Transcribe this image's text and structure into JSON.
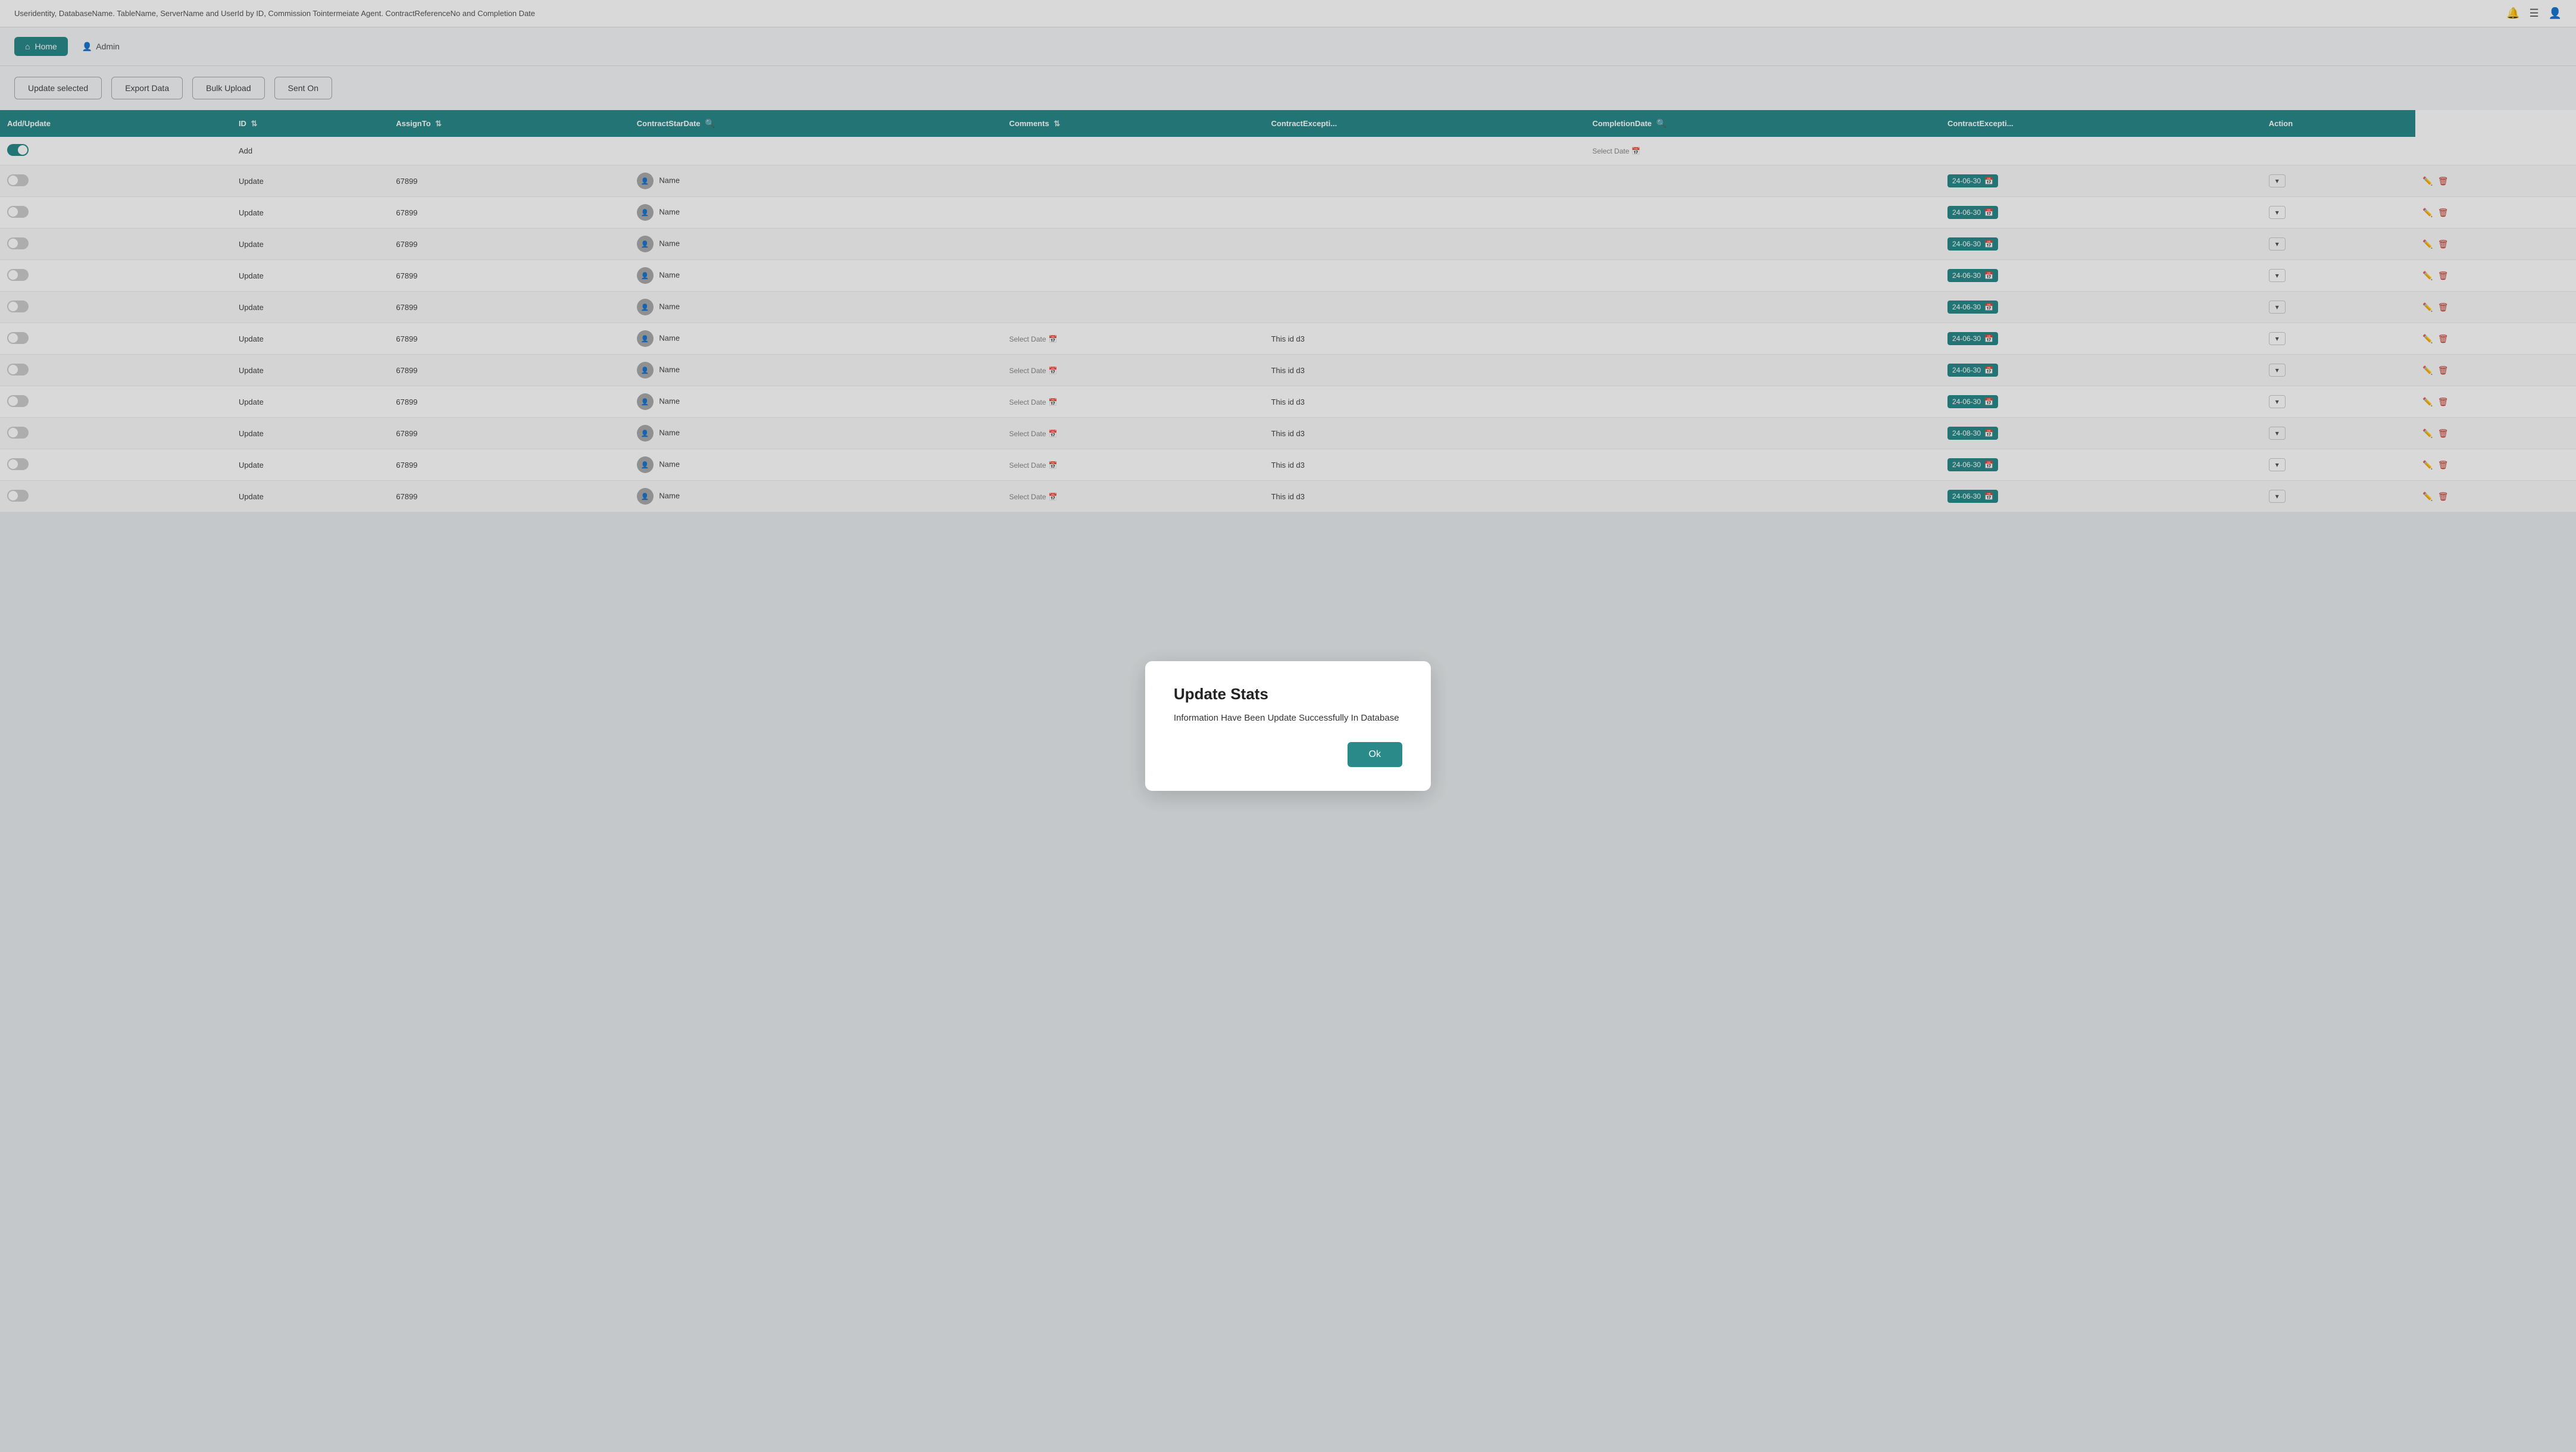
{
  "topbar": {
    "title": "Useridentity, DatabaseName. TableName, ServerName and UserId by ID, Commission Tointermeiate Agent. ContractReferenceNo and Completion Date",
    "icons": {
      "bell": "🔔",
      "menu": "☰",
      "user": "👤"
    }
  },
  "nav": {
    "home_label": "Home",
    "admin_label": "Admin"
  },
  "toolbar": {
    "update_selected_label": "Update selected",
    "export_data_label": "Export Data",
    "bulk_upload_label": "Bulk Upload",
    "sent_on_label": "Sent On"
  },
  "table": {
    "headers": [
      {
        "key": "add_update",
        "label": "Add/Update",
        "sortable": false
      },
      {
        "key": "id",
        "label": "ID",
        "sortable": true
      },
      {
        "key": "assign_to",
        "label": "AssignTo",
        "sortable": true
      },
      {
        "key": "contract_start_date",
        "label": "ContractStarDate",
        "sortable": false,
        "searchable": true
      },
      {
        "key": "comments",
        "label": "Comments",
        "sortable": true
      },
      {
        "key": "contract_exception",
        "label": "ContractExcepti...",
        "sortable": false
      },
      {
        "key": "completion_date",
        "label": "CompletionDate",
        "sortable": false,
        "searchable": true
      },
      {
        "key": "contract_exception2",
        "label": "ContractExcepti...",
        "sortable": false
      },
      {
        "key": "action",
        "label": "Action",
        "sortable": false
      }
    ],
    "add_row": {
      "toggle": "on",
      "label": "Add",
      "select_date": "Select Date"
    },
    "rows": [
      {
        "id": "67899",
        "name": "Name",
        "contract_start_date": null,
        "date_chip": "24-06-30",
        "comment": null,
        "completion_date": "24-06-30",
        "toggle": "off"
      },
      {
        "id": "67899",
        "name": "Name",
        "contract_start_date": null,
        "date_chip": "24-06-30",
        "comment": null,
        "completion_date": "24-06-30",
        "toggle": "off"
      },
      {
        "id": "67899",
        "name": "Name",
        "contract_start_date": null,
        "date_chip": "24-06-30",
        "comment": null,
        "completion_date": "24-06-30",
        "toggle": "off"
      },
      {
        "id": "67899",
        "name": "Name",
        "contract_start_date": null,
        "date_chip": "24-06-30",
        "comment": null,
        "completion_date": "24-06-30",
        "toggle": "off"
      },
      {
        "id": "67899",
        "name": "Name",
        "contract_start_date": null,
        "date_chip": "24-06-30",
        "comment": null,
        "completion_date": "24-06-30",
        "toggle": "off"
      },
      {
        "id": "67899",
        "name": "Name",
        "contract_start_date": "Select Date",
        "date_chip": null,
        "comment": "This id d3",
        "completion_date": "24-06-30",
        "toggle": "off"
      },
      {
        "id": "67899",
        "name": "Name",
        "contract_start_date": "Select Date",
        "date_chip": null,
        "comment": "This id d3",
        "completion_date": "24-06-30",
        "toggle": "off"
      },
      {
        "id": "67899",
        "name": "Name",
        "contract_start_date": "Select Date",
        "date_chip": null,
        "comment": "This id d3",
        "completion_date": "24-06-30",
        "toggle": "off"
      },
      {
        "id": "67899",
        "name": "Name",
        "contract_start_date": "Select Date",
        "date_chip": null,
        "comment": "This id d3",
        "completion_date": "24-08-30",
        "toggle": "off"
      },
      {
        "id": "67899",
        "name": "Name",
        "contract_start_date": "Select Date",
        "date_chip": null,
        "comment": "This id d3",
        "completion_date": "24-06-30",
        "toggle": "off"
      },
      {
        "id": "67899",
        "name": "Name",
        "contract_start_date": "Select Date",
        "date_chip": null,
        "comment": "This id d3",
        "completion_date": "24-06-30",
        "toggle": "off"
      }
    ],
    "update_label": "Update"
  },
  "modal": {
    "title": "Update Stats",
    "message": "Information Have Been Update Successfully In Database",
    "ok_label": "Ok"
  }
}
